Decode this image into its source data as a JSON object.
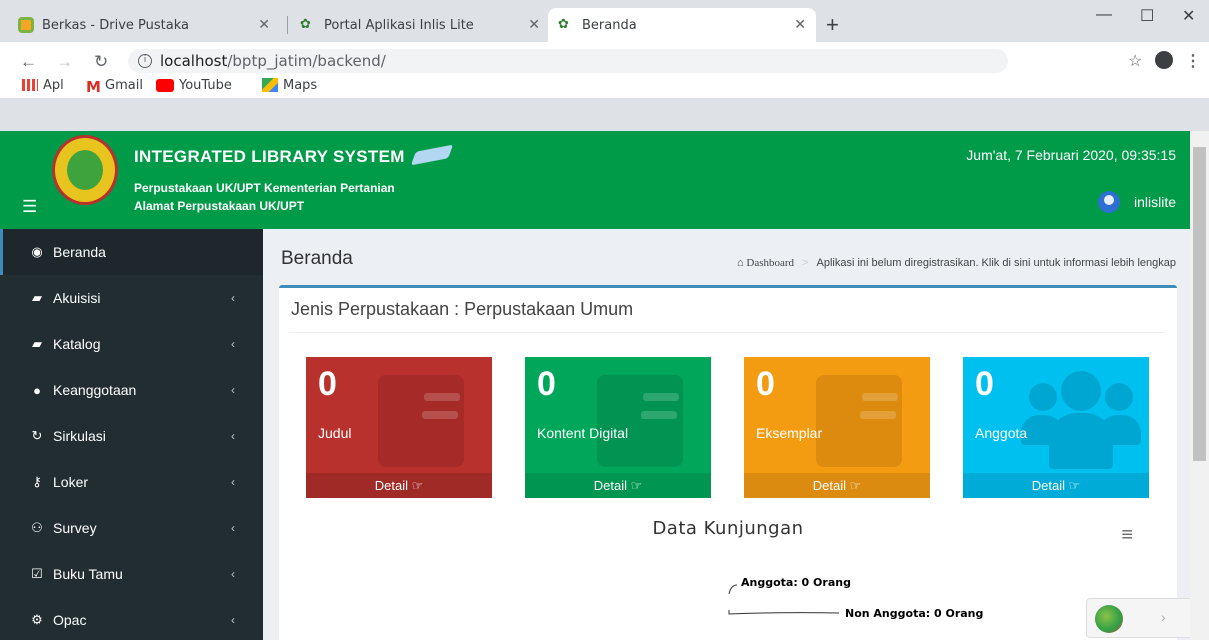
{
  "browser": {
    "tabs": [
      {
        "title": "Berkas - Drive Pustaka",
        "favicon": "drive-icon",
        "active": false
      },
      {
        "title": "Portal Aplikasi Inlis Lite",
        "favicon": "leaf-icon",
        "active": false
      },
      {
        "title": "Beranda",
        "favicon": "leaf-icon",
        "active": true
      }
    ],
    "url_host": "localhost",
    "url_path": "/bptp_jatim/backend/",
    "bookmarks": [
      {
        "label": "Apl",
        "icon": "apps-icon"
      },
      {
        "label": "Gmail",
        "icon": "gmail-icon"
      },
      {
        "label": "YouTube",
        "icon": "youtube-icon"
      },
      {
        "label": "Maps",
        "icon": "maps-icon"
      }
    ]
  },
  "header": {
    "brand": "INTEGRATED LIBRARY SYSTEM",
    "subtitle1": "Perpustakaan UK/UPT Kementerian Pertanian",
    "subtitle2": "Alamat Perpustakaan UK/UPT",
    "datetime": "Jum'at, 7 Februari 2020, 09:35:15",
    "username": "inlislite"
  },
  "sidebar": {
    "items": [
      {
        "label": "Beranda",
        "icon": "dashboard-icon",
        "active": true
      },
      {
        "label": "Akuisisi",
        "icon": "book-icon"
      },
      {
        "label": "Katalog",
        "icon": "book-icon"
      },
      {
        "label": "Keanggotaan",
        "icon": "user-icon"
      },
      {
        "label": "Sirkulasi",
        "icon": "refresh-icon"
      },
      {
        "label": "Loker",
        "icon": "key-icon"
      },
      {
        "label": "Survey",
        "icon": "users-icon"
      },
      {
        "label": "Buku Tamu",
        "icon": "check-square-icon"
      },
      {
        "label": "Opac",
        "icon": "gears-icon"
      }
    ]
  },
  "content": {
    "title": "Beranda",
    "breadcrumb_home": "Dashboard",
    "breadcrumb_notice": "Aplikasi ini belum diregistrasikan. Klik di sini untuk informasi lebih lengkap",
    "box_title": "Jenis Perpustakaan : Perpustakaan Umum",
    "stats": [
      {
        "value": "0",
        "label": "Judul",
        "detail": "Detail",
        "color": "#b8312c"
      },
      {
        "value": "0",
        "label": "Kontent Digital",
        "detail": "Detail",
        "color": "#00a65a"
      },
      {
        "value": "0",
        "label": "Eksemplar",
        "detail": "Detail",
        "color": "#f39c12"
      },
      {
        "value": "0",
        "label": "Anggota",
        "detail": "Detail",
        "color": "#00c0ef"
      }
    ],
    "chart_title": "Data Kunjungan"
  },
  "chart_data": {
    "type": "pie",
    "title": "Data Kunjungan",
    "categories": [
      "Anggota",
      "Non Anggota"
    ],
    "values": [
      0,
      0
    ],
    "data_labels": [
      "Anggota: 0 Orang",
      "Non Anggota: 0 Orang"
    ]
  }
}
